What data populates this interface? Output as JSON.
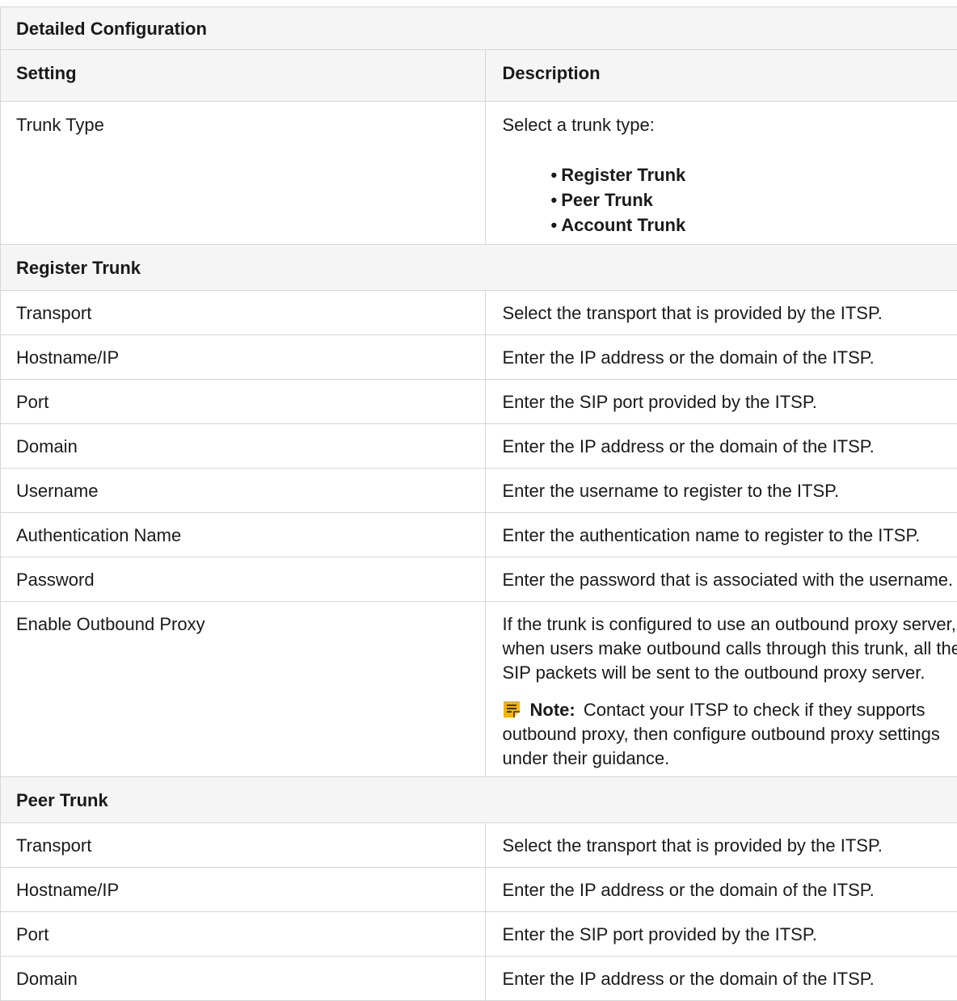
{
  "table": {
    "title": "Detailed Configuration",
    "headers": [
      "Setting",
      "Description"
    ],
    "trunk_type": {
      "setting": "Trunk Type",
      "description": "Select a trunk type:",
      "options": [
        "Register Trunk",
        "Peer Trunk",
        "Account Trunk"
      ]
    },
    "sections": [
      {
        "title": "Register Trunk",
        "rows": [
          {
            "setting": "Transport",
            "description": "Select the transport that is provided by the ITSP."
          },
          {
            "setting": "Hostname/IP",
            "description": "Enter the IP address or the domain of the ITSP."
          },
          {
            "setting": "Port",
            "description": "Enter the SIP port provided by the ITSP."
          },
          {
            "setting": "Domain",
            "description": "Enter the IP address or the domain of the ITSP."
          },
          {
            "setting": "Username",
            "description": "Enter the username to register to the ITSP."
          },
          {
            "setting": "Authentication Name",
            "description": "Enter the authentication name to register to the ITSP."
          },
          {
            "setting": "Password",
            "description": "Enter the password that is associated with the username."
          },
          {
            "setting": "Enable Outbound Proxy",
            "description": "If the trunk is configured to use an outbound proxy server, when users make outbound calls through this trunk, all the SIP packets will be sent to the outbound proxy server.",
            "note_label": "Note:",
            "note_text": "Contact your ITSP to check if they supports outbound proxy, then configure outbound proxy settings under their guidance."
          }
        ]
      },
      {
        "title": "Peer Trunk",
        "rows": [
          {
            "setting": "Transport",
            "description": "Select the transport that is provided by the ITSP."
          },
          {
            "setting": "Hostname/IP",
            "description": "Enter the IP address or the domain of the ITSP."
          },
          {
            "setting": "Port",
            "description": "Enter the SIP port provided by the ITSP."
          },
          {
            "setting": "Domain",
            "description": "Enter the IP address or the domain of the ITSP."
          }
        ]
      }
    ]
  },
  "colors": {
    "header_background": "#f5f5f5",
    "border": "#d6d6d6",
    "note_icon": "#f5b301"
  },
  "icons": {
    "note": "note-icon"
  }
}
